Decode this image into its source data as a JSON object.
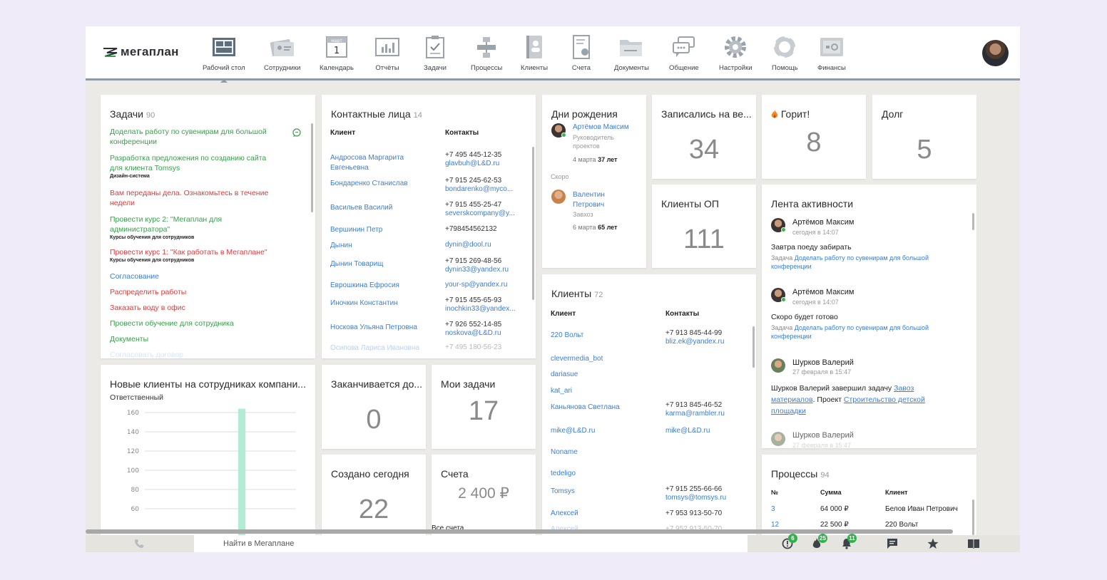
{
  "app": {
    "logo": "мегаплан"
  },
  "nav": [
    {
      "label": "Рабочий стол",
      "icon": "desktop-icon"
    },
    {
      "label": "Сотрудники",
      "icon": "employees-icon"
    },
    {
      "label": "Календарь",
      "icon": "calendar-icon",
      "cal_month": "март",
      "cal_day": "1"
    },
    {
      "label": "Отчёты",
      "icon": "reports-icon"
    },
    {
      "label": "Задачи",
      "icon": "tasks-icon"
    },
    {
      "label": "Процессы",
      "icon": "processes-icon"
    },
    {
      "label": "Клиенты",
      "icon": "clients-icon"
    },
    {
      "label": "Счета",
      "icon": "invoices-icon"
    },
    {
      "label": "Документы",
      "icon": "documents-icon"
    },
    {
      "label": "Общение",
      "icon": "chat-icon"
    },
    {
      "label": "Настройки",
      "icon": "settings-icon"
    },
    {
      "label": "Помощь",
      "icon": "help-icon"
    },
    {
      "label": "Финансы",
      "icon": "finance-icon"
    }
  ],
  "tasks": {
    "title": "Задачи",
    "count": "90",
    "items": [
      {
        "text": "Доделать работу по сувенирам для большой конференции",
        "color": "g",
        "sub": ""
      },
      {
        "text": "Разработка предложения по созданию сайта для клиента Tomsys",
        "color": "g",
        "sub": "Дизайн-система"
      },
      {
        "text": "Вам переданы дела. Ознакомьтесь в течение недели",
        "color": "r",
        "sub": ""
      },
      {
        "text": "Провести курс 2: \"Мегаплан для администратора\"",
        "color": "g",
        "sub": "Курсы обучения для сотрудников"
      },
      {
        "text": "Провести курс 1: \"Как работать в Мегаплане\"",
        "color": "r",
        "sub": "Курсы обучения для сотрудников"
      },
      {
        "text": "Согласование",
        "color": "b",
        "sub": ""
      },
      {
        "text": "Распределить работы",
        "color": "r",
        "sub": ""
      },
      {
        "text": "Заказать воду в офис",
        "color": "r",
        "sub": ""
      },
      {
        "text": "Провести обучение для сотрудника",
        "color": "g",
        "sub": ""
      },
      {
        "text": "Документы",
        "color": "g",
        "sub": ""
      },
      {
        "text": "Согласовать договор",
        "color": "b",
        "sub": ""
      }
    ]
  },
  "contacts": {
    "title": "Контактные лица",
    "count": "14",
    "col_client": "Клиент",
    "col_contacts": "Контакты",
    "rows": [
      {
        "name": "Андросова Маргарита Евгеньевна",
        "phone": "+7 495 445-12-35",
        "email": "glavbuh@L&D.ru"
      },
      {
        "name": "Бондаренко Станислав",
        "phone": "+7 915 245-62-53",
        "email": "bondarenko@myco..."
      },
      {
        "name": "Васильев Василий",
        "phone": "+7 915 455-25-47",
        "email": "severskcompany@y..."
      },
      {
        "name": "Вершинин Петр",
        "phone": "+798454562132",
        "email": ""
      },
      {
        "name": "Дынин",
        "phone": "",
        "email": "dynin@dool.ru"
      },
      {
        "name": "Дынин Товарищ",
        "phone": "+7 915 269-48-56",
        "email": "dynin33@yandex.ru"
      },
      {
        "name": "Еврошкина Ефросия",
        "phone": "",
        "email": "your-sp@yandex.ru"
      },
      {
        "name": "Иночкин Константин",
        "phone": "+7 915 455-65-93",
        "email": "inochkin33@yandex..."
      },
      {
        "name": "Носкова Ульяна Петровна",
        "phone": "+7 926 552-14-85",
        "email": "noskova@L&D.ru"
      },
      {
        "name": "Осипова Лариса Ивановна",
        "phone": "+7 495 180-56-23",
        "email": ""
      }
    ]
  },
  "birthdays": {
    "title": "Дни рождения",
    "first": {
      "name": "Артёмов Максим",
      "role": "Руководитель проектов",
      "date": "4 марта",
      "age": "37 лет"
    },
    "soon_label": "Скоро",
    "second": {
      "name": "Валентин Петрович",
      "role": "Завхоз",
      "date": "6 марта",
      "age": "65 лет"
    }
  },
  "signed": {
    "title": "Записались на ве...",
    "value": "34"
  },
  "hot": {
    "title": "Горит!",
    "value": "8"
  },
  "debt": {
    "title": "Долг",
    "value": "5"
  },
  "clients_op": {
    "title": "Клиенты ОП",
    "value": "111"
  },
  "feed": {
    "title": "Лента активности",
    "entries": [
      {
        "name": "Артёмов Максим",
        "time": "сегодня в 14:07",
        "text": "Завтра поеду забирать",
        "task_prefix": "Задача",
        "task": "Доделать работу по сувенирам для большой конференции"
      },
      {
        "name": "Артёмов Максим",
        "time": "сегодня в 14:07",
        "text": "Скоро будет готово",
        "task_prefix": "Задача",
        "task": "Доделать работу по сувенирам для большой конференции"
      },
      {
        "name": "Шурков Валерий",
        "time": "27 февраля в 15:47",
        "text_pre": "Шурков Валерий завершил задачу",
        "link1": "Завоз материалов",
        "text_mid": ". Проект",
        "link2": "Строительство детской площадки"
      },
      {
        "name": "Шурков Валерий",
        "time": "27 февраля в 15:47"
      }
    ]
  },
  "clients": {
    "title": "Клиенты",
    "count": "72",
    "col_client": "Клиент",
    "col_contacts": "Контакты",
    "rows": [
      {
        "name": "220 Вольт",
        "phone": "+7 913 845-44-99",
        "email": "bliz.ek@yandex.ru"
      },
      {
        "name": "clevermedia_bot",
        "phone": "",
        "email": ""
      },
      {
        "name": "dariasue",
        "phone": "",
        "email": ""
      },
      {
        "name": "kat_ari",
        "phone": "",
        "email": ""
      },
      {
        "name": "Каньянова Светлана",
        "phone": "+7 913 845-46-52",
        "email": "karma@rambler.ru"
      },
      {
        "name": "mike@L&D.ru",
        "phone": "",
        "email": "mike@L&D.ru"
      },
      {
        "name": "Noname",
        "phone": "",
        "email": ""
      },
      {
        "name": "tedeligo",
        "phone": "",
        "email": ""
      },
      {
        "name": "Tomsys",
        "phone": "+7 915 255-66-66",
        "email": "tomsys@tomsys.ru"
      },
      {
        "name": "Алексей",
        "phone": "+7 953 913-50-70",
        "email": ""
      },
      {
        "name": "Алексей",
        "phone": "+7 952 913-50-70",
        "email": ""
      }
    ]
  },
  "new_clients": {
    "title": "Новые клиенты на сотрудниках компани...",
    "subtitle": "Ответственный"
  },
  "chart_data": {
    "type": "bar",
    "title": "Новые клиенты на сотрудниках компани...",
    "xlabel": "Ответственный",
    "ylabel": "",
    "yticks": [
      60,
      80,
      100,
      120,
      140,
      160
    ],
    "ylim": [
      50,
      170
    ],
    "categories": [
      ""
    ],
    "values": [
      164
    ],
    "bar_color": "#b3ecd4"
  },
  "ending": {
    "title": "Заканчивается до...",
    "value": "0"
  },
  "my_tasks": {
    "title": "Мои задачи",
    "value": "17"
  },
  "created_today": {
    "title": "Создано сегодня",
    "value": "22"
  },
  "invoices": {
    "title": "Счета",
    "value": "2 400 ₽",
    "link": "Все счета"
  },
  "processes": {
    "title": "Процессы",
    "count": "94",
    "col_num": "№",
    "col_sum": "Сумма",
    "col_client": "Клиент",
    "rows": [
      {
        "num": "3",
        "sum": "64 000 ₽",
        "client": "Белов Иван Петрович"
      },
      {
        "num": "12",
        "sum": "22 500 ₽",
        "client": "220 Вольт"
      }
    ]
  },
  "bottom": {
    "search_placeholder": "Найти в Мегаплане",
    "badge_alerts": "6",
    "badge_hot": "25",
    "badge_bell": "11"
  },
  "colors": {
    "green": "#36a14a",
    "red": "#e33a3a",
    "blue": "#3b7dd8",
    "badge": "#2fb14c"
  }
}
